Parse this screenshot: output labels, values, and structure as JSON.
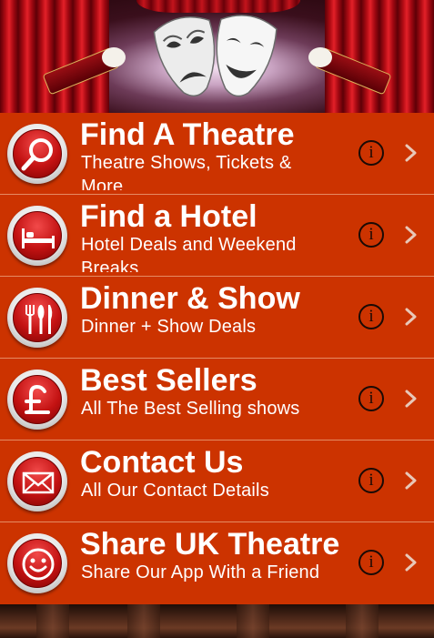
{
  "header": {
    "image_name": "theatre-curtain-masks-banner"
  },
  "menu": {
    "items": [
      {
        "title": "Find A Theatre",
        "subtitle": "Theatre Shows, Tickets & More",
        "icon": "magnifier-icon",
        "info": "i"
      },
      {
        "title": "Find a Hotel",
        "subtitle": "Hotel Deals and Weekend Breaks",
        "icon": "bed-icon",
        "info": "i"
      },
      {
        "title": "Dinner & Show",
        "subtitle": "Dinner + Show Deals",
        "icon": "cutlery-icon",
        "info": "i"
      },
      {
        "title": "Best Sellers",
        "subtitle": "All The Best Selling shows",
        "icon": "pound-icon",
        "info": "i"
      },
      {
        "title": "Contact Us",
        "subtitle": "All Our Contact Details",
        "icon": "envelope-icon",
        "info": "i"
      },
      {
        "title": "Share UK Theatre",
        "subtitle": "Share Our App With a Friend",
        "icon": "smiley-icon",
        "info": "i"
      }
    ]
  },
  "colors": {
    "row_background": "#cc3300",
    "row_divider": "#e58b63",
    "text": "#ffffff",
    "icon_red": "#c31212"
  }
}
